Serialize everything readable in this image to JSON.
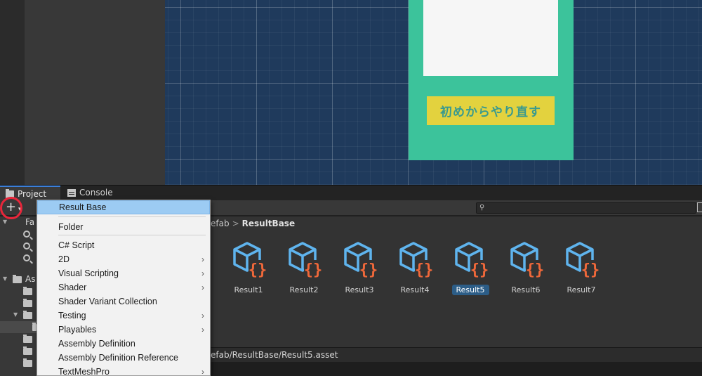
{
  "scene": {
    "restart_button_label": "初めからやり直す"
  },
  "tabs": [
    {
      "label": "Project",
      "icon": "folder-icon"
    },
    {
      "label": "Console",
      "icon": "console-icon"
    }
  ],
  "toolbar": {
    "add_symbol": "+",
    "add_caret": "▾",
    "search_value": ""
  },
  "tree": {
    "favorites_label": "Fa",
    "assets_label": "As"
  },
  "breadcrumb": {
    "prefix": "efab",
    "separator": ">",
    "current": "ResultBase"
  },
  "assets": [
    {
      "name": "Result1",
      "selected": false
    },
    {
      "name": "Result2",
      "selected": false
    },
    {
      "name": "Result3",
      "selected": false
    },
    {
      "name": "Result4",
      "selected": false
    },
    {
      "name": "Result5",
      "selected": true
    },
    {
      "name": "Result6",
      "selected": false
    },
    {
      "name": "Result7",
      "selected": false
    }
  ],
  "status": {
    "path": "efab/ResultBase/Result5.asset"
  },
  "context_menu": {
    "items": [
      {
        "label": "Result Base",
        "submenu": false,
        "highlighted": true
      },
      {
        "label": "Folder",
        "submenu": false
      },
      {
        "label": "C# Script",
        "submenu": false
      },
      {
        "label": "2D",
        "submenu": true
      },
      {
        "label": "Visual Scripting",
        "submenu": true
      },
      {
        "label": "Shader",
        "submenu": true
      },
      {
        "label": "Shader Variant Collection",
        "submenu": false
      },
      {
        "label": "Testing",
        "submenu": true
      },
      {
        "label": "Playables",
        "submenu": true
      },
      {
        "label": "Assembly Definition",
        "submenu": false
      },
      {
        "label": "Assembly Definition Reference",
        "submenu": false
      },
      {
        "label": "TextMeshPro",
        "submenu": true
      }
    ],
    "submenu_glyph": "›"
  },
  "colors": {
    "scene_bg": "#1f3a5c",
    "game_panel": "#3cc39b",
    "button_yellow": "#e3d23e",
    "highlight_blue": "#9ccbf3",
    "annotation_red": "#e8263a",
    "asset_cube": "#5fb4ee",
    "asset_braces": "#f0683a"
  }
}
